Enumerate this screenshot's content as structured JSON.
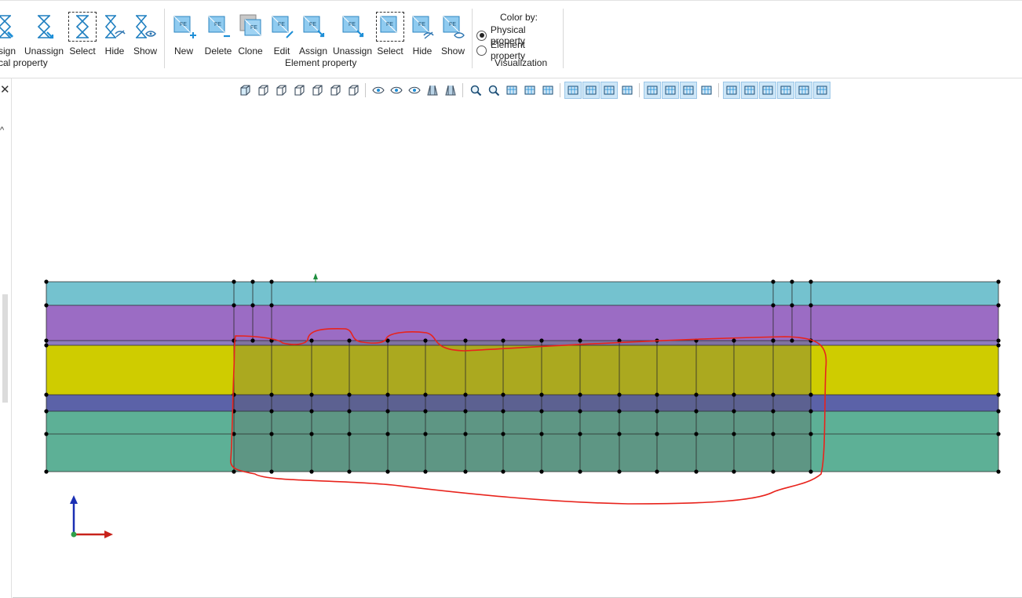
{
  "ribbon": {
    "physical_group": {
      "buttons": [
        "ssign",
        "Unassign",
        "Select",
        "Hide",
        "Show"
      ],
      "label": "cal property"
    },
    "element_group": {
      "buttons": [
        "New",
        "Delete",
        "Clone",
        "Edit",
        "Assign",
        "Unassign",
        "Select",
        "Hide",
        "Show"
      ],
      "label": "Element property",
      "icon_text": "FE"
    },
    "visualization": {
      "title": "Color by:",
      "options": [
        "Physical property",
        "Element property"
      ],
      "selected": "Physical property",
      "label": "Visualization"
    }
  },
  "left_panel": {
    "close": "✕",
    "collapse": "^"
  },
  "view_toolbar": {
    "icons": [
      "iso-view-icon",
      "front-view-icon",
      "back-view-icon",
      "top-view-icon",
      "bottom-view-icon",
      "left-view-icon",
      "right-view-icon",
      "hide-eye-icon",
      "show-eye-icon",
      "show-all-icon",
      "perspective-icon",
      "section-icon",
      "zoom-fit-icon",
      "zoom-icon",
      "screenshot-icon",
      "pick-icon",
      "grid-icon",
      "mesh-toggle-icon",
      "axes-toggle-icon",
      "check-box-icon",
      "check-edit-icon",
      "node-icon",
      "surface-icon",
      "solid-icon",
      "axis-icon",
      "sel-1-icon",
      "sel-2-icon",
      "sel-3-icon",
      "sel-4-icon",
      "sel-5-icon",
      "sel-6-icon"
    ],
    "active": [
      "mesh-toggle-icon",
      "axes-toggle-icon",
      "check-box-icon",
      "node-icon",
      "surface-icon",
      "solid-icon",
      "sel-1-icon",
      "sel-2-icon",
      "sel-3-icon",
      "sel-4-icon",
      "sel-5-icon",
      "sel-6-icon"
    ]
  },
  "colors": {
    "layer_cyan": "#74c2cf",
    "layer_purple": "#9b6cc4",
    "layer_yellow": "#cfcc00",
    "layer_blue": "#5b62a8",
    "layer_teal": "#5db096",
    "highlight_overlay": "#606060",
    "node": "#000000",
    "annotation": "#e8231c",
    "axis_x": "#c8221b",
    "axis_y": "#1a2fb4",
    "accent": "#1f8fd7"
  }
}
